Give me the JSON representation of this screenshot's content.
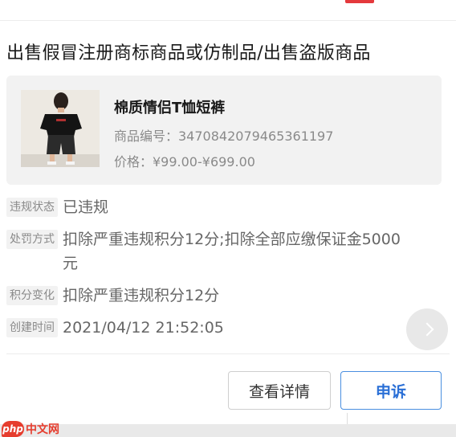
{
  "page": {
    "title": "出售假冒注册商标商品或仿制品/出售盗版商品"
  },
  "product": {
    "name": "棉质情侣T恤短裤",
    "id_line": "商品编号：3470842079465361197",
    "price_line": "价格：¥99.00-¥699.00"
  },
  "details": [
    {
      "label": "违规状态",
      "value": "已违规"
    },
    {
      "label": "处罚方式",
      "value": "扣除严重违规积分12分;扣除全部应缴保证金5000元"
    },
    {
      "label": "积分变化",
      "value": "扣除严重违规积分12分"
    },
    {
      "label": "创建时间",
      "value": "2021/04/12 21:52:05"
    }
  ],
  "actions": {
    "detail_label": "查看详情",
    "appeal_label": "申诉"
  },
  "watermark": {
    "logo": "php",
    "text": "中文网"
  },
  "colors": {
    "accent": "#2a6fd6",
    "brand_red": "#e63d2e"
  },
  "icons": {
    "next": "chevron-right-icon"
  }
}
